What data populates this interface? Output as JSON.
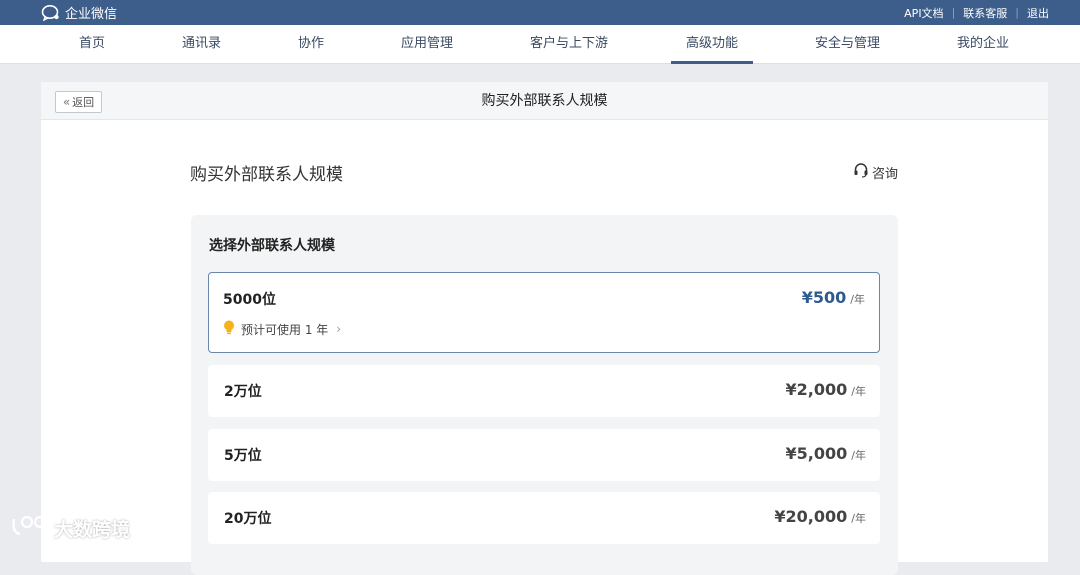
{
  "topbar": {
    "brand": "企业微信",
    "links": [
      "API文档",
      "联系客服",
      "退出"
    ],
    "bg_color": "#3d5d8a"
  },
  "nav": {
    "items": [
      "首页",
      "通讯录",
      "协作",
      "应用管理",
      "客户与上下游",
      "高级功能",
      "安全与管理",
      "我的企业"
    ],
    "active": "高级功能"
  },
  "panel": {
    "back_label": "返回",
    "title": "购买外部联系人规模"
  },
  "main": {
    "section_title": "购买外部联系人规模",
    "consult_label": "咨询",
    "card_title": "选择外部联系人规模",
    "options": [
      {
        "label": "5000位",
        "price": "¥500",
        "unit": "/年",
        "hint": "预计可使用 1 年",
        "selected": true
      },
      {
        "label": "2万位",
        "price": "¥2,000",
        "unit": "/年"
      },
      {
        "label": "5万位",
        "price": "¥5,000",
        "unit": "/年"
      },
      {
        "label": "20万位",
        "price": "¥20,000",
        "unit": "/年"
      }
    ]
  },
  "watermark": "大数跨境",
  "colors": {
    "accent": "#2f5a8f",
    "selected_border": "#6b86ab",
    "hint_icon": "#f5b21b"
  }
}
